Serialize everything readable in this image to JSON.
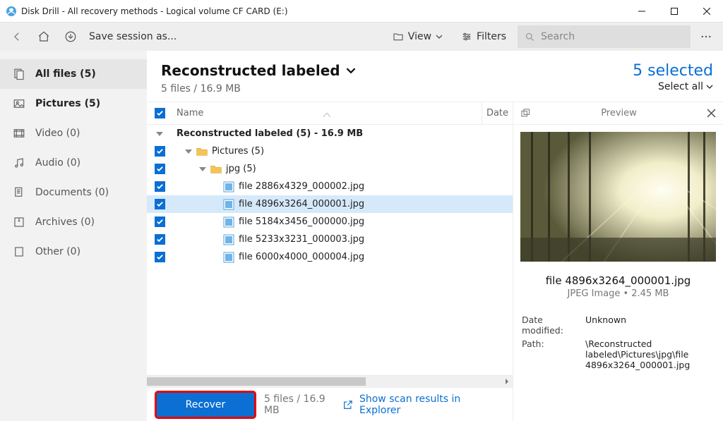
{
  "window": {
    "title": "Disk Drill - All recovery methods - Logical volume CF CARD (E:)"
  },
  "toolbar": {
    "save_session": "Save session as...",
    "view": "View",
    "filters": "Filters",
    "search_placeholder": "Search"
  },
  "sidebar": {
    "items": [
      {
        "label": "All files (5)"
      },
      {
        "label": "Pictures (5)"
      },
      {
        "label": "Video (0)"
      },
      {
        "label": "Audio (0)"
      },
      {
        "label": "Documents (0)"
      },
      {
        "label": "Archives (0)"
      },
      {
        "label": "Other (0)"
      }
    ]
  },
  "header": {
    "title": "Reconstructed labeled",
    "subtitle": "5 files / 16.9 MB",
    "selected": "5 selected",
    "select_all": "Select all"
  },
  "columns": {
    "name": "Name",
    "date": "Date"
  },
  "tree": {
    "root": "Reconstructed labeled (5) - 16.9 MB",
    "pictures": "Pictures (5)",
    "jpg": "jpg (5)",
    "files": [
      "file 2886x4329_000002.jpg",
      "file 4896x3264_000001.jpg",
      "file 5184x3456_000000.jpg",
      "file 5233x3231_000003.jpg",
      "file 6000x4000_000004.jpg"
    ]
  },
  "footer": {
    "recover": "Recover",
    "summary": "5 files / 16.9 MB",
    "explorer": "Show scan results in Explorer"
  },
  "preview": {
    "title": "Preview",
    "filename": "file 4896x3264_000001.jpg",
    "meta": "JPEG Image • 2.45 MB",
    "date_k": "Date modified:",
    "date_v": "Unknown",
    "path_k": "Path:",
    "path_v": "\\Reconstructed labeled\\Pictures\\jpg\\file 4896x3264_000001.jpg"
  }
}
